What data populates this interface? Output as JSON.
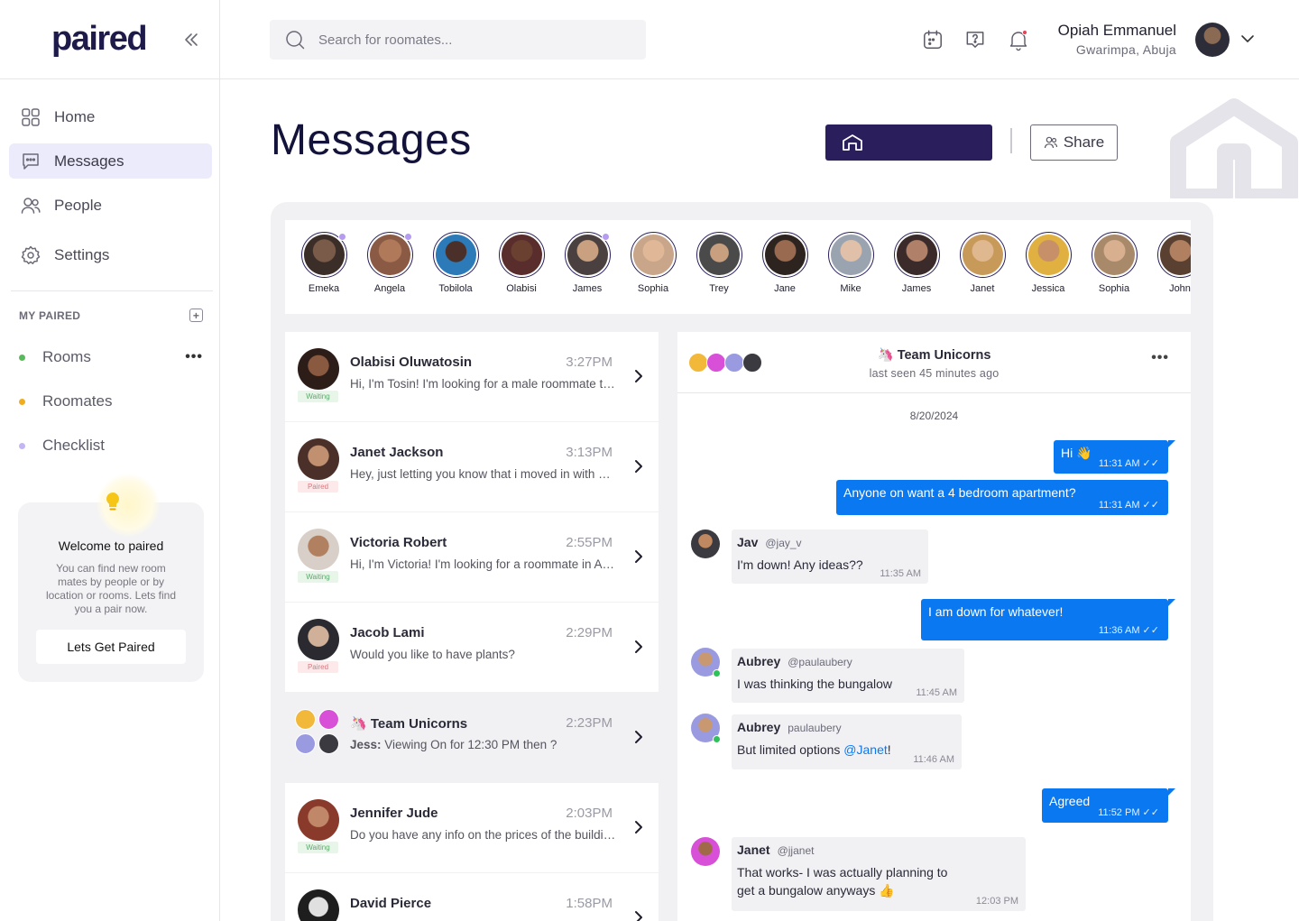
{
  "app": {
    "logo": "paired"
  },
  "sidebar": {
    "nav": [
      {
        "label": "Home",
        "icon": "grid-icon"
      },
      {
        "label": "Messages",
        "icon": "chat-icon"
      },
      {
        "label": "People",
        "icon": "people-icon"
      },
      {
        "label": "Settings",
        "icon": "gear-icon"
      }
    ],
    "section_title": "MY PAIRED",
    "groups": [
      {
        "label": "Rooms",
        "color": "#5cb85c"
      },
      {
        "label": "Roomates",
        "color": "#f0ad1e"
      },
      {
        "label": "Checklist",
        "color": "#c4b5f5"
      }
    ],
    "welcome": {
      "title": "Welcome to paired",
      "body": "You can find new room mates by people or by location or rooms. Lets find you a pair now.",
      "button": "Lets Get Paired"
    }
  },
  "topbar": {
    "search_placeholder": "Search for roomates...",
    "user": {
      "name": "Opiah Emmanuel",
      "location": "Gwarimpa, Abuja"
    }
  },
  "main": {
    "title": "Messages",
    "share_label": "Share"
  },
  "stories": [
    {
      "name": "Emeka",
      "online": true,
      "color": "#3b2d28"
    },
    {
      "name": "Angela",
      "online": true,
      "color": "#8a5a44"
    },
    {
      "name": "Tobilola",
      "online": false,
      "color": "#2d5a8a"
    },
    {
      "name": "Olabisi",
      "online": false,
      "color": "#5a2d2d"
    },
    {
      "name": "James",
      "online": true,
      "color": "#4a4040"
    },
    {
      "name": "Sophia",
      "online": false,
      "color": "#c9a68a"
    },
    {
      "name": "Trey",
      "online": false,
      "color": "#6b6b6b"
    },
    {
      "name": "Jane",
      "online": false,
      "color": "#7a5440"
    },
    {
      "name": "Mike",
      "online": false,
      "color": "#9aa4b0"
    },
    {
      "name": "James",
      "online": false,
      "color": "#3a2a2a"
    },
    {
      "name": "Janet",
      "online": false,
      "color": "#c79a5a"
    },
    {
      "name": "Jessica",
      "online": false,
      "color": "#b07a4a"
    },
    {
      "name": "Sophia",
      "online": false,
      "color": "#a88a6a"
    },
    {
      "name": "John",
      "online": false,
      "color": "#5a4030"
    }
  ],
  "conversations": [
    {
      "name": "Olabisi Oluwatosin",
      "time": "3:27PM",
      "preview": "Hi, I'm Tosin! I'm looking for a male roommate to share a place",
      "badge": "Waiting",
      "color": "#4a3028"
    },
    {
      "name": "Janet Jackson",
      "time": "3:13PM",
      "preview": "Hey, just letting you know that i moved in with my friend",
      "badge": "Paired",
      "color": "#6a4a3a"
    },
    {
      "name": "Victoria Robert",
      "time": "2:55PM",
      "preview": "Hi, I'm Victoria! I'm looking for a roommate in Abuja",
      "badge": "Waiting",
      "color": "#a07a5a"
    },
    {
      "name": "Jacob Lami",
      "time": "2:29PM",
      "preview": "Would you like to have plants?",
      "badge": "Paired",
      "color": "#2a2a30"
    },
    {
      "name": "Team Unicorns",
      "emoji": "🦄",
      "time": "2:23PM",
      "sender": "Jess:",
      "preview": "Viewing On for 12:30 PM then ?",
      "group": true
    },
    {
      "name": "Jennifer Jude",
      "time": "2:03PM",
      "preview": "Do you have any info on the prices of the building?",
      "badge": "Waiting",
      "color": "#8a4a3a"
    },
    {
      "name": "David Pierce",
      "time": "1:58PM",
      "preview": "",
      "badge": "",
      "color": "#2a2a2a"
    }
  ],
  "chat": {
    "title": "Team Unicorns",
    "emoji": "🦄",
    "subtitle": "last seen 45 minutes ago",
    "date": "8/20/2024",
    "messages": [
      {
        "dir": "out",
        "text": "Hi 👋",
        "time": "11:31 AM"
      },
      {
        "dir": "out",
        "text": "Anyone on want a 4 bedroom apartment?",
        "time": "11:31 AM"
      },
      {
        "dir": "in",
        "sender": "Jav",
        "handle": "@jay_v",
        "text": "I'm down! Any ideas??",
        "time": "11:35 AM"
      },
      {
        "dir": "out",
        "text": "I am down for whatever!",
        "time": "11:36 AM"
      },
      {
        "dir": "in",
        "sender": "Aubrey",
        "handle": "@paulaubery",
        "text": "I was thinking the bungalow",
        "time": "11:45 AM"
      },
      {
        "dir": "in",
        "sender": "Aubrey",
        "handle": "paulaubery",
        "text_before": "But limited options ",
        "mention": "@Janet",
        "text_after": "!",
        "time": "11:46 AM"
      },
      {
        "dir": "out",
        "text": "Agreed",
        "time": "11:52 PM"
      },
      {
        "dir": "in",
        "sender": "Janet",
        "handle": "@jjanet",
        "text_line1": "That works- I was actually planning to",
        "text_line2": "get a bungalow anyways 👍",
        "time": "12:03 PM"
      }
    ]
  },
  "colors": {
    "brand": "#1e1b4b",
    "accent": "#0a78f0",
    "primary_button": "#2a1f5c"
  }
}
